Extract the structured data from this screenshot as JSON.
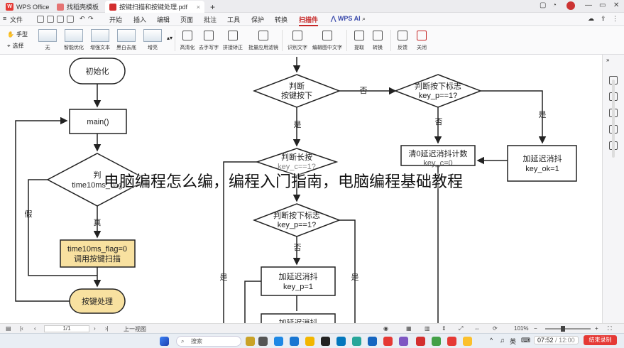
{
  "titlebar": {
    "tabs": [
      {
        "label": "WPS Office",
        "icon": "wps-logo"
      },
      {
        "label": "找稻壳模板",
        "icon": "docer-icon"
      },
      {
        "label": "按键扫描和按键处理.pdf",
        "icon": "pdf-icon"
      }
    ],
    "new_tab": "+"
  },
  "menubar": {
    "file": "文件",
    "items": [
      "开始",
      "插入",
      "编辑",
      "页面",
      "批注",
      "工具",
      "保护",
      "转换",
      "扫描件"
    ],
    "active": "扫描件",
    "ai": "WPS AI"
  },
  "ribbon": {
    "hand_tool": "手型",
    "select_tool": "选择",
    "filters": [
      "无",
      "智能优化",
      "增强文本",
      "黑白去底",
      "增亮"
    ],
    "tools": [
      "高清化",
      "去手写字",
      "拼接矫正",
      "批量应用滤镜",
      "识别文字",
      "编辑图中文字",
      "提取",
      "转换",
      "反馈",
      "关闭"
    ]
  },
  "flowchart": {
    "init": "初始化",
    "main": "main()",
    "decision1_top": "判",
    "decision1_bottom": "time10ms_flag",
    "false_label": "假",
    "true_label": "真",
    "process1_line1": "time10ms_flag=0",
    "process1_line2": "调用按键扫描",
    "key_handler": "按键处理",
    "decision_key_pressed_1": "判断",
    "decision_key_pressed_2": "按键按下",
    "no_label": "否",
    "yes_label": "是",
    "decision_flag_1": "判断按下标志",
    "decision_flag_2": "key_p==1?",
    "no_label2": "否",
    "yes_label2": "是",
    "clear_box_1": "清0延迟消抖计数",
    "clear_box_2": "key_c=0",
    "debounce_ok_1": "加延迟消抖",
    "debounce_ok_2": "key_ok=1",
    "long_press_1": "判断长按",
    "long_press_2": "key_c==1?",
    "decision_flag2_1": "判断按下标志",
    "decision_flag2_2": "key_p==1?",
    "no_label3": "否",
    "debounce_p_1": "加延迟消抖",
    "debounce_p_2": "key_p=1",
    "partial_box": "加延迟消抖",
    "yes_label3": "是",
    "yes_label4": "是"
  },
  "overlay_text": "电脑编程怎么编，编程入门指南，电脑编程基础教程",
  "statusbar": {
    "page": "1/1",
    "view": "上一视图",
    "zoom": "101%"
  },
  "taskbar": {
    "search": "搜索",
    "ime": "英",
    "time": "07:52",
    "duration": "12:00",
    "record_button": "结束录制"
  }
}
